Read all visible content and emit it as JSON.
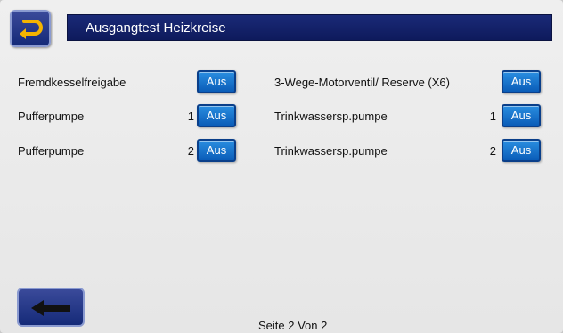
{
  "header": {
    "title": "Ausgangtest Heizkreise",
    "home_icon": "return-arrow-icon"
  },
  "left_rows": [
    {
      "label": "Fremdkesselfreigabe",
      "index": "",
      "value": "Aus"
    },
    {
      "label": "Pufferpumpe",
      "index": "1",
      "value": "Aus"
    },
    {
      "label": "Pufferpumpe",
      "index": "2",
      "value": "Aus"
    }
  ],
  "right_rows": [
    {
      "label": "3-Wege-Motorventil/ Reserve (X6)",
      "index": "",
      "value": "Aus"
    },
    {
      "label": "Trinkwassersp.pumpe",
      "index": "1",
      "value": "Aus"
    },
    {
      "label": "Trinkwassersp.pumpe",
      "index": "2",
      "value": "Aus"
    }
  ],
  "footer": {
    "back_icon": "arrow-left-icon",
    "page_info": "Seite  2 Von 2"
  },
  "colors": {
    "title_bar": "#0e1a5c",
    "toggle_button": "#1a7ad0",
    "background": "#ececec"
  }
}
